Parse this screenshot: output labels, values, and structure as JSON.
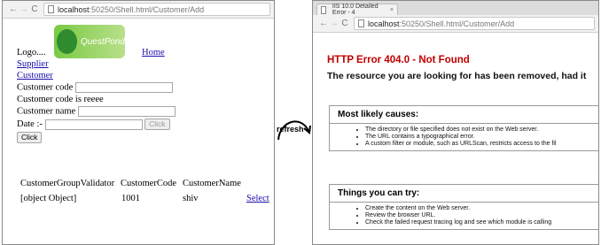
{
  "left": {
    "nav": {
      "back": "←",
      "forward": "→",
      "reload": "C"
    },
    "address": {
      "host": "localhost",
      "path": ":50250/Shell.html/Customer/Add"
    },
    "logo_prefix": "Logo....",
    "logo_text": "QuestPond",
    "home_link": "Home",
    "supplier_link": "Supplier",
    "customer_link": "Customer",
    "customer_code_label": "Customer code",
    "code_validation_msg": "Customer code is reeee",
    "customer_name_label": "Customer name",
    "date_label": "Date :-",
    "date_click_button": "Click",
    "click_button": "Click",
    "table": {
      "headers": [
        "CustomerGroupValidator",
        "CustomerCode",
        "CustomerName"
      ],
      "row": {
        "validator": "[object Object]",
        "code": "1001",
        "name": "shiv",
        "action": "Select"
      }
    }
  },
  "arrow_label": "refresh",
  "right": {
    "tab_title": "IIS 10.0 Detailed Error - 4",
    "tab_close": "×",
    "nav": {
      "back": "←",
      "forward": "→",
      "reload": "C"
    },
    "address": {
      "host": "localhost",
      "path": ":50250/Shell.html/Customer/Add"
    },
    "error_title": "HTTP Error 404.0 - Not Found",
    "error_message": "The resource you are looking for has been removed, had it",
    "causes": {
      "heading": "Most likely causes:",
      "items": [
        "The directory or file specified does not exist on the Web server.",
        "The URL contains a typographical error.",
        "A custom filter or module, such as URLScan, restricts access to the fil"
      ]
    },
    "try": {
      "heading": "Things you can try:",
      "items": [
        "Create the content on the Web server.",
        "Review the browser URL.",
        "Check the failed request tracing log and see which module is calling"
      ]
    }
  }
}
